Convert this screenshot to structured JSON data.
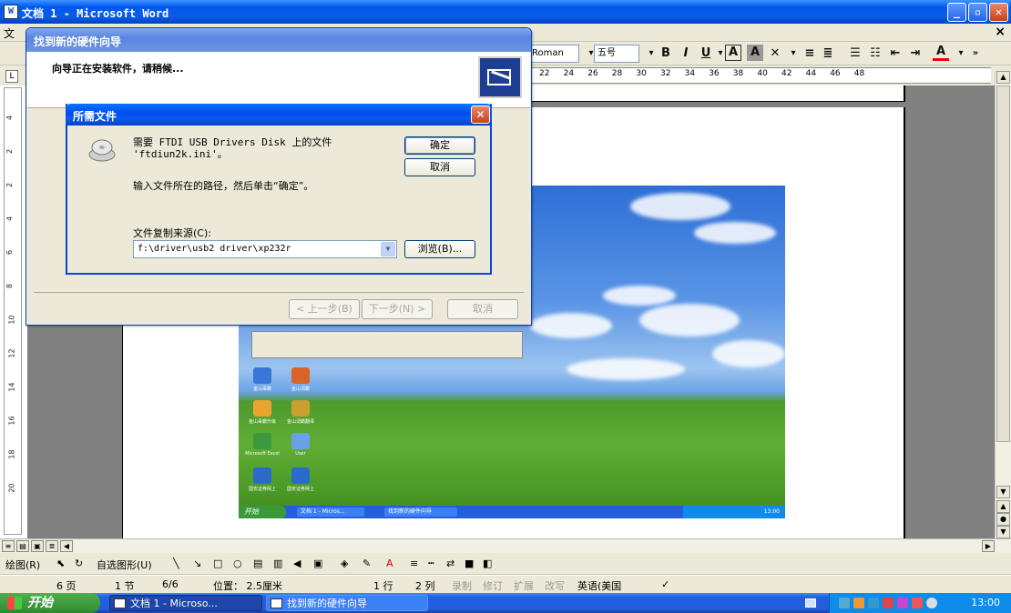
{
  "word": {
    "title": "文档 1 - Microsoft Word",
    "menu_label": "文",
    "font_name": "Roman",
    "font_size": "五号",
    "ruler_ticks": [
      "22",
      "24",
      "26",
      "28",
      "30",
      "32",
      "34",
      "36",
      "38",
      "40",
      "42",
      "44",
      "46",
      "48"
    ],
    "ruler_corner": "L",
    "vruler_ticks": [
      "4",
      "2",
      "2",
      "4",
      "6",
      "8",
      "10",
      "12",
      "14",
      "16",
      "18",
      "20"
    ],
    "draw_label": "绘图(R)",
    "autoshape_label": "自选图形(U)",
    "status": {
      "page": "6 页",
      "section": "1 节",
      "page_of": "6/6",
      "position": "位置： 2.5厘米",
      "line": "1 行",
      "col": "2 列",
      "rec": "录制",
      "trk": "修订",
      "ext": "扩展",
      "ovr": "改写",
      "lang": "英语(美国"
    }
  },
  "taskbar": {
    "start": "开始",
    "tasks": [
      "文档 1 - Microso...",
      "找到新的硬件向导"
    ],
    "clock": "13:00"
  },
  "wizard": {
    "title": "找到新的硬件向导",
    "heading": "向导正在安装软件，请稍候...",
    "back": "< 上一步(B)",
    "next": "下一步(N) >",
    "cancel": "取消"
  },
  "dialog": {
    "title": "所需文件",
    "message_line1": "需要 FTDI USB Drivers Disk 上的文件",
    "message_line2": "'ftdiun2k.ini'。",
    "instruction": "输入文件所在的路径，然后单击“确定”。",
    "source_label": "文件复制来源(C):",
    "path_value": "f:\\driver\\usb2 driver\\xp232r",
    "ok": "确定",
    "cancel": "取消",
    "browse": "浏览(B)..."
  },
  "embedded_screenshot": {
    "start": "开始",
    "tasks": [
      "文档 1 - Micros...",
      "找到新的硬件向导"
    ],
    "clock": "13:00",
    "desktop_icons": [
      "金山毒霸",
      "金山词霸",
      "金山毒霸升级",
      "金山词霸翻译",
      "Microsoft Excel",
      "User",
      "国安证券网上",
      "国安证券网上"
    ]
  },
  "colors": {
    "xp_blue": "#0058ee",
    "start_green": "#3a9a3a",
    "tray_blue": "#0f8bea",
    "dialog_face": "#ece9d8"
  }
}
